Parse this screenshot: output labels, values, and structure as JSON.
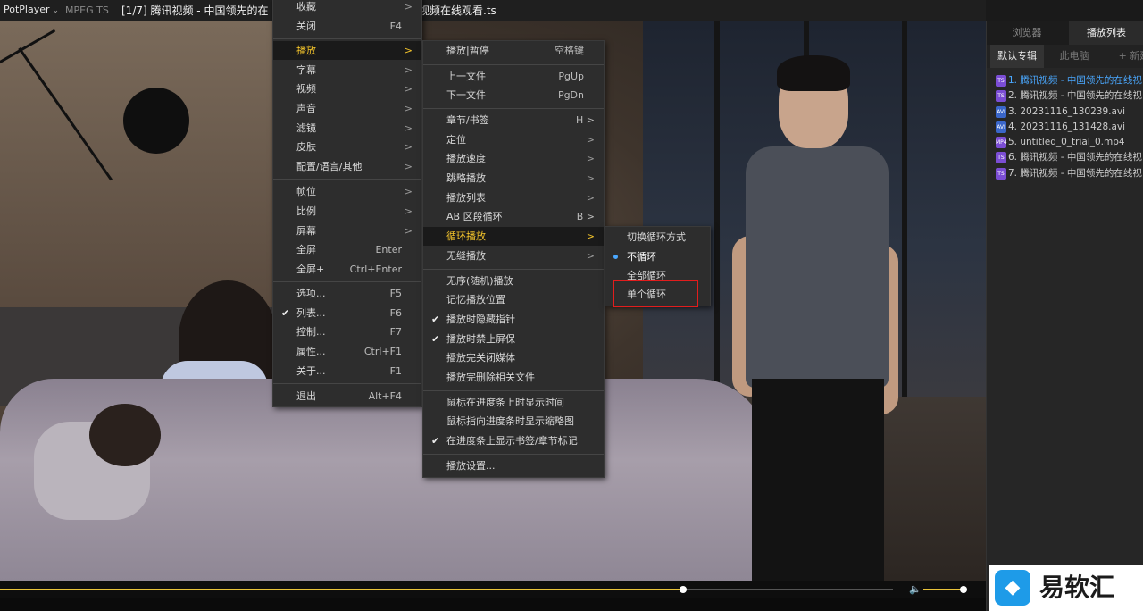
{
  "titlebar": {
    "app_name": "PotPlayer",
    "codec": "MPEG TS",
    "title_start": "[1/7] 腾讯视频 - 中国领先的在",
    "title_end": "视频在线观看.ts"
  },
  "right_panel": {
    "tabs": [
      "浏览器",
      "播放列表"
    ],
    "subtabs": [
      "默认专辑",
      "此电脑",
      "+ 新建"
    ],
    "playlist": [
      {
        "label": "1. 腾讯视频 - 中国领先的在线视",
        "icon": "TS",
        "active": true
      },
      {
        "label": "2. 腾讯视频 - 中国领先的在线视",
        "icon": "TS",
        "active": false
      },
      {
        "label": "3. 20231116_130239.avi",
        "icon": "AVI",
        "active": false
      },
      {
        "label": "4. 20231116_131428.avi",
        "icon": "AVI",
        "active": false
      },
      {
        "label": "5. untitled_0_trial_0.mp4",
        "icon": "MP4",
        "active": false
      },
      {
        "label": "6. 腾讯视频 - 中国领先的在线视",
        "icon": "TS",
        "active": false
      },
      {
        "label": "7. 腾讯视频 - 中国领先的在线视",
        "icon": "TS",
        "active": false
      }
    ]
  },
  "menu_main": {
    "items": [
      {
        "label": "收藏",
        "arrow": ">"
      },
      {
        "label": "关闭",
        "shortcut": "F4"
      },
      {
        "label": "播放",
        "arrow": ">",
        "highlight": true
      },
      {
        "label": "字幕",
        "arrow": ">"
      },
      {
        "label": "视频",
        "arrow": ">"
      },
      {
        "label": "声音",
        "arrow": ">"
      },
      {
        "label": "滤镜",
        "arrow": ">"
      },
      {
        "label": "皮肤",
        "arrow": ">"
      },
      {
        "label": "配置/语言/其他",
        "arrow": ">"
      },
      {
        "label": "帧位",
        "arrow": ">"
      },
      {
        "label": "比例",
        "arrow": ">"
      },
      {
        "label": "屏幕",
        "arrow": ">"
      },
      {
        "label": "全屏",
        "shortcut": "Enter"
      },
      {
        "label": "全屏+",
        "shortcut": "Ctrl+Enter"
      },
      {
        "label": "选项...",
        "shortcut": "F5"
      },
      {
        "label": "列表...",
        "shortcut": "F6",
        "checked": true
      },
      {
        "label": "控制...",
        "shortcut": "F7"
      },
      {
        "label": "属性...",
        "shortcut": "Ctrl+F1"
      },
      {
        "label": "关于...",
        "shortcut": "F1"
      },
      {
        "label": "退出",
        "shortcut": "Alt+F4"
      }
    ]
  },
  "menu_play": {
    "items": [
      {
        "label": "播放|暂停",
        "shortcut": "空格键"
      },
      {
        "label": "上一文件",
        "shortcut": "PgUp"
      },
      {
        "label": "下一文件",
        "shortcut": "PgDn"
      },
      {
        "label": "章节/书签",
        "shortcut": "H >"
      },
      {
        "label": "定位",
        "arrow": ">"
      },
      {
        "label": "播放速度",
        "arrow": ">"
      },
      {
        "label": "跳略播放",
        "arrow": ">"
      },
      {
        "label": "播放列表",
        "arrow": ">"
      },
      {
        "label": "AB 区段循环",
        "shortcut": "B >"
      },
      {
        "label": "循环播放",
        "arrow": ">",
        "highlight": true
      },
      {
        "label": "无缝播放",
        "arrow": ">"
      },
      {
        "label": "无序(随机)播放"
      },
      {
        "label": "记忆播放位置"
      },
      {
        "label": "播放时隐藏指针",
        "checked": true
      },
      {
        "label": "播放时禁止屏保",
        "checked": true
      },
      {
        "label": "播放完关闭媒体"
      },
      {
        "label": "播放完删除相关文件"
      },
      {
        "label": "鼠标在进度条上时显示时间"
      },
      {
        "label": "鼠标指向进度条时显示缩略图"
      },
      {
        "label": "在进度条上显示书签/章节标记",
        "checked": true
      },
      {
        "label": "播放设置..."
      }
    ]
  },
  "menu_loop": {
    "items": [
      {
        "label": "切换循环方式"
      },
      {
        "label": "不循环",
        "selected": true
      },
      {
        "label": "全部循环"
      },
      {
        "label": "单个循环"
      }
    ]
  },
  "playback": {
    "progress": 0.765,
    "volume": 0.9
  },
  "watermark": {
    "logo_glyph": "◆",
    "text": "易软汇"
  }
}
